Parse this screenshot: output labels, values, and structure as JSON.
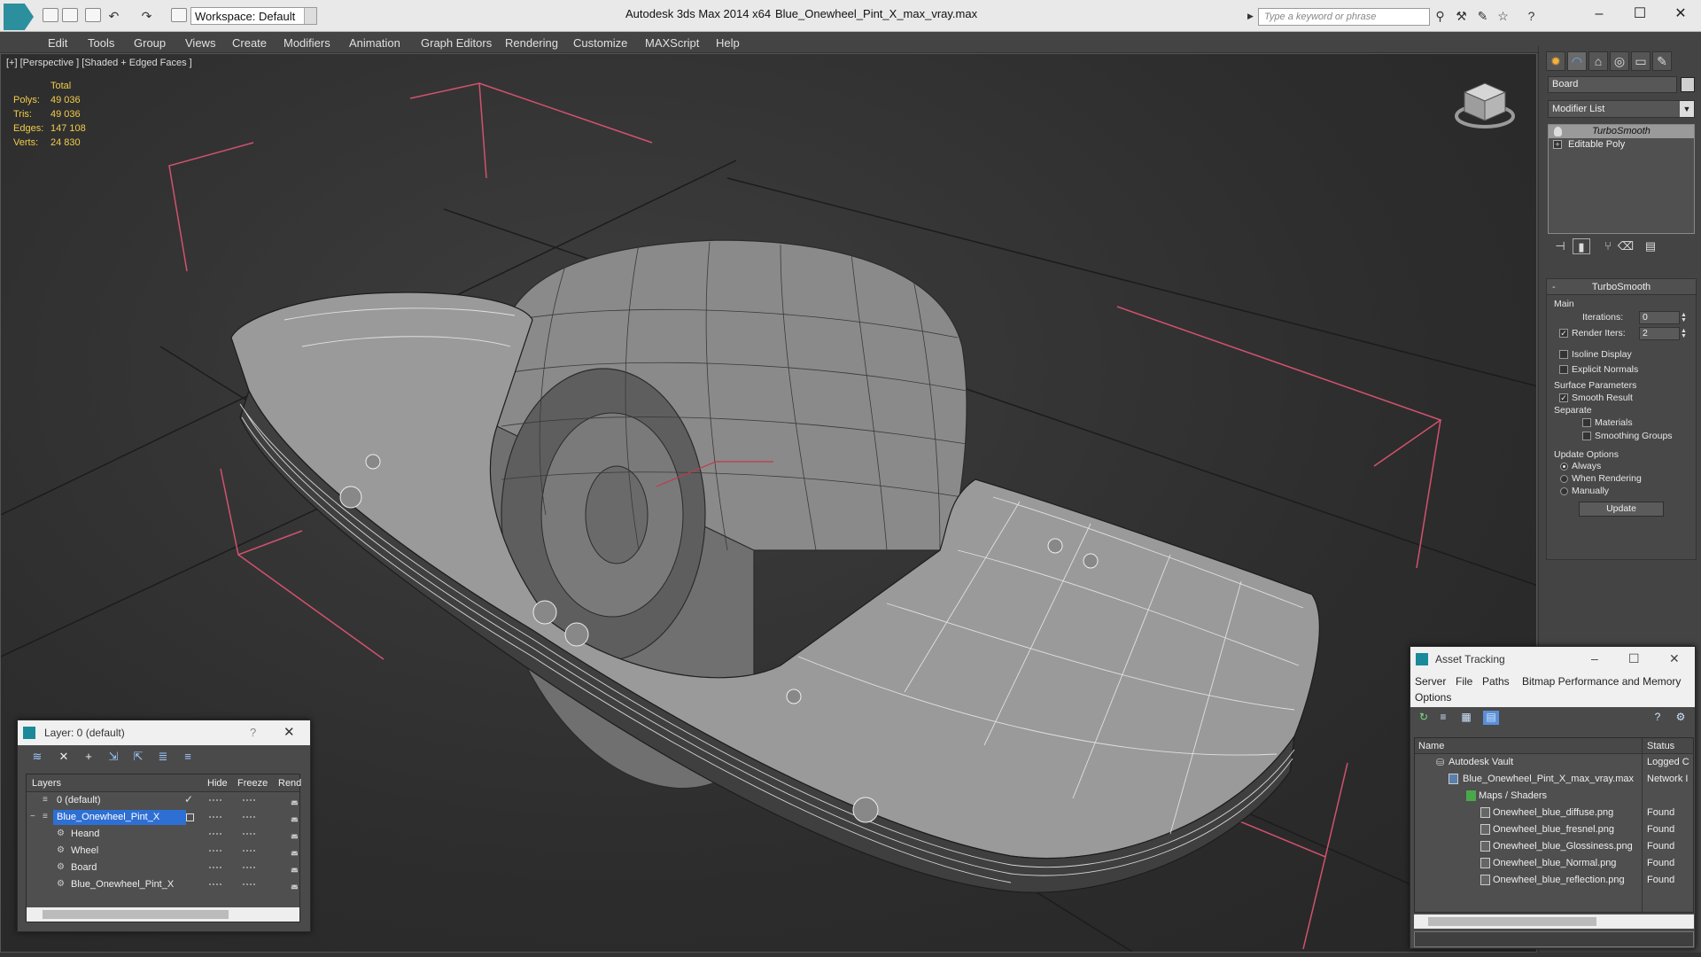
{
  "titlebar": {
    "workspace": "Workspace: Default",
    "app_title": "Autodesk 3ds Max  2014 x64",
    "file_title": "Blue_Onewheel_Pint_X_max_vray.max",
    "search_placeholder": "Type a keyword or phrase"
  },
  "menu": [
    "Edit",
    "Tools",
    "Group",
    "Views",
    "Create",
    "Modifiers",
    "Animation",
    "Graph Editors",
    "Rendering",
    "Customize",
    "MAXScript",
    "Help"
  ],
  "viewport": {
    "label": "[+] [Perspective ] [Shaded + Edged Faces ]",
    "stats": {
      "header": "Total",
      "polys_label": "Polys:",
      "polys": "49 036",
      "tris_label": "Tris:",
      "tris": "49 036",
      "edges_label": "Edges:",
      "edges": "147 108",
      "verts_label": "Verts:",
      "verts": "24 830"
    }
  },
  "command_panel": {
    "object_name": "Board",
    "modifier_list": "Modifier List",
    "stack": [
      "TurboSmooth",
      "Editable Poly"
    ],
    "turbosmooth": {
      "title": "TurboSmooth",
      "main": "Main",
      "iterations_label": "Iterations:",
      "iterations": "0",
      "render_iters_label": "Render Iters:",
      "render_iters": "2",
      "isoline": "Isoline Display",
      "explicit_normals": "Explicit Normals",
      "surface_params": "Surface Parameters",
      "smooth_result": "Smooth Result",
      "separate": "Separate",
      "materials": "Materials",
      "smoothing_groups": "Smoothing Groups",
      "update_options": "Update Options",
      "always": "Always",
      "when_rendering": "When Rendering",
      "manually": "Manually",
      "update_button": "Update"
    }
  },
  "layer_window": {
    "title": "Layer: 0 (default)",
    "help": "?",
    "columns": {
      "layers": "Layers",
      "hide": "Hide",
      "freeze": "Freeze",
      "render": "Rend"
    },
    "rows": [
      {
        "name": "0 (default)"
      },
      {
        "name": "Blue_Onewheel_Pint_X"
      },
      {
        "name": "Heand"
      },
      {
        "name": "Wheel"
      },
      {
        "name": "Board"
      },
      {
        "name": "Blue_Onewheel_Pint_X"
      }
    ]
  },
  "asset_tracking": {
    "title": "Asset Tracking",
    "menu": [
      "Server",
      "File",
      "Paths",
      "Bitmap Performance and Memory",
      "Options"
    ],
    "columns": {
      "name": "Name",
      "status": "Status"
    },
    "rows": [
      {
        "name": "Autodesk Vault",
        "status": "Logged C"
      },
      {
        "name": "Blue_Onewheel_Pint_X_max_vray.max",
        "status": "Network I"
      },
      {
        "name": "Maps / Shaders",
        "status": ""
      },
      {
        "name": "Onewheel_blue_diffuse.png",
        "status": "Found"
      },
      {
        "name": "Onewheel_blue_fresnel.png",
        "status": "Found"
      },
      {
        "name": "Onewheel_blue_Glossiness.png",
        "status": "Found"
      },
      {
        "name": "Onewheel_blue_Normal.png",
        "status": "Found"
      },
      {
        "name": "Onewheel_blue_reflection.png",
        "status": "Found"
      }
    ]
  }
}
